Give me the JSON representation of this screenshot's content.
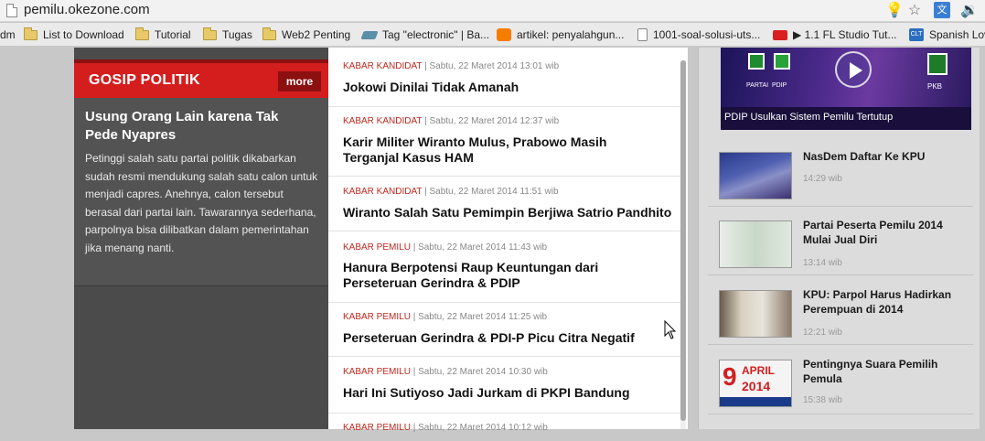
{
  "browser": {
    "url": "pemilu.okezone.com"
  },
  "bookmarks": [
    {
      "label": "List to Download",
      "icon": "folder-icon"
    },
    {
      "label": "Tutorial",
      "icon": "folder-icon"
    },
    {
      "label": "Tugas",
      "icon": "folder-icon"
    },
    {
      "label": "Web2 Penting",
      "icon": "folder-icon"
    },
    {
      "label": "Tag \"electronic\" | Ba...",
      "icon": "tag-icon"
    },
    {
      "label": "artikel: penyalahgun...",
      "icon": "blogger-icon"
    },
    {
      "label": "1001-soal-solusi-uts...",
      "icon": "page-icon"
    },
    {
      "label": "▶ 1.1 FL Studio Tut...",
      "icon": "youtube-icon"
    },
    {
      "label": "Spanish Lov",
      "icon": "clt-icon"
    }
  ],
  "bookmark_cut_prefix": "dm",
  "gosip": {
    "section_title": "GOSIP POLITIK",
    "more_label": "more",
    "headline": "Usung Orang Lain karena Tak Pede Nyapres",
    "body": "Petinggi salah satu partai politik dikabarkan sudah resmi mendukung salah satu calon untuk menjadi capres. Anehnya, calon tersebut berasal dari partai lain. Tawarannya sederhana, parpolnya bisa dilibatkan dalam pemerintahan jika menang nanti."
  },
  "news": [
    {
      "category": "KABAR KANDIDAT",
      "date": "Sabtu, 22 Maret 2014 13:01 wib",
      "title": "Jokowi Dinilai Tidak Amanah"
    },
    {
      "category": "KABAR KANDIDAT",
      "date": "Sabtu, 22 Maret 2014 12:37 wib",
      "title": "Karir Militer Wiranto Mulus, Prabowo Masih",
      "title2": "Terganjal Kasus HAM"
    },
    {
      "category": "KABAR KANDIDAT",
      "date": "Sabtu, 22 Maret 2014 11:51 wib",
      "title": "Wiranto Salah Satu Pemimpin Berjiwa Satrio Pandhito"
    },
    {
      "category": "KABAR PEMILU",
      "date": "Sabtu, 22 Maret 2014 11:43 wib",
      "title": "Hanura Berpotensi Raup Keuntungan dari",
      "title2": "Perseteruan Gerindra & PDIP"
    },
    {
      "category": "KABAR PEMILU",
      "date": "Sabtu, 22 Maret 2014 11:25 wib",
      "title": "Perseteruan Gerindra & PDI-P Picu Citra Negatif"
    },
    {
      "category": "KABAR PEMILU",
      "date": "Sabtu, 22 Maret 2014 10:30 wib",
      "title": "Hari Ini Sutiyoso Jadi Jurkam di PKPI Bandung"
    },
    {
      "category": "KABAR PEMILU",
      "date": "Sabtu, 22 Maret 2014 10:12 wib",
      "title": ""
    }
  ],
  "video": {
    "caption": "PDIP Usulkan Sistem Pemilu Tertutup",
    "logo_labels": [
      "PARTAI",
      "PDIP",
      "PKB"
    ]
  },
  "sidebar_news": [
    {
      "title": "NasDem Daftar Ke KPU",
      "time": "14:29 wib"
    },
    {
      "title": "Partai Peserta Pemilu 2014 Mulai Jual Diri",
      "time": "13:14 wib"
    },
    {
      "title": "KPU: Parpol Harus Hadirkan Perempuan di 2014",
      "time": "12:21 wib"
    },
    {
      "title": "Pentingnya Suara Pemilih Pemula",
      "time": "15:38 wib"
    }
  ],
  "thumb_texts": {
    "poster_day": "9",
    "poster_month": "APRIL",
    "poster_year": "2014"
  },
  "colors": {
    "accent_red": "#d41e1e",
    "dark_red": "#8c1010",
    "category_red": "#c0281e"
  }
}
